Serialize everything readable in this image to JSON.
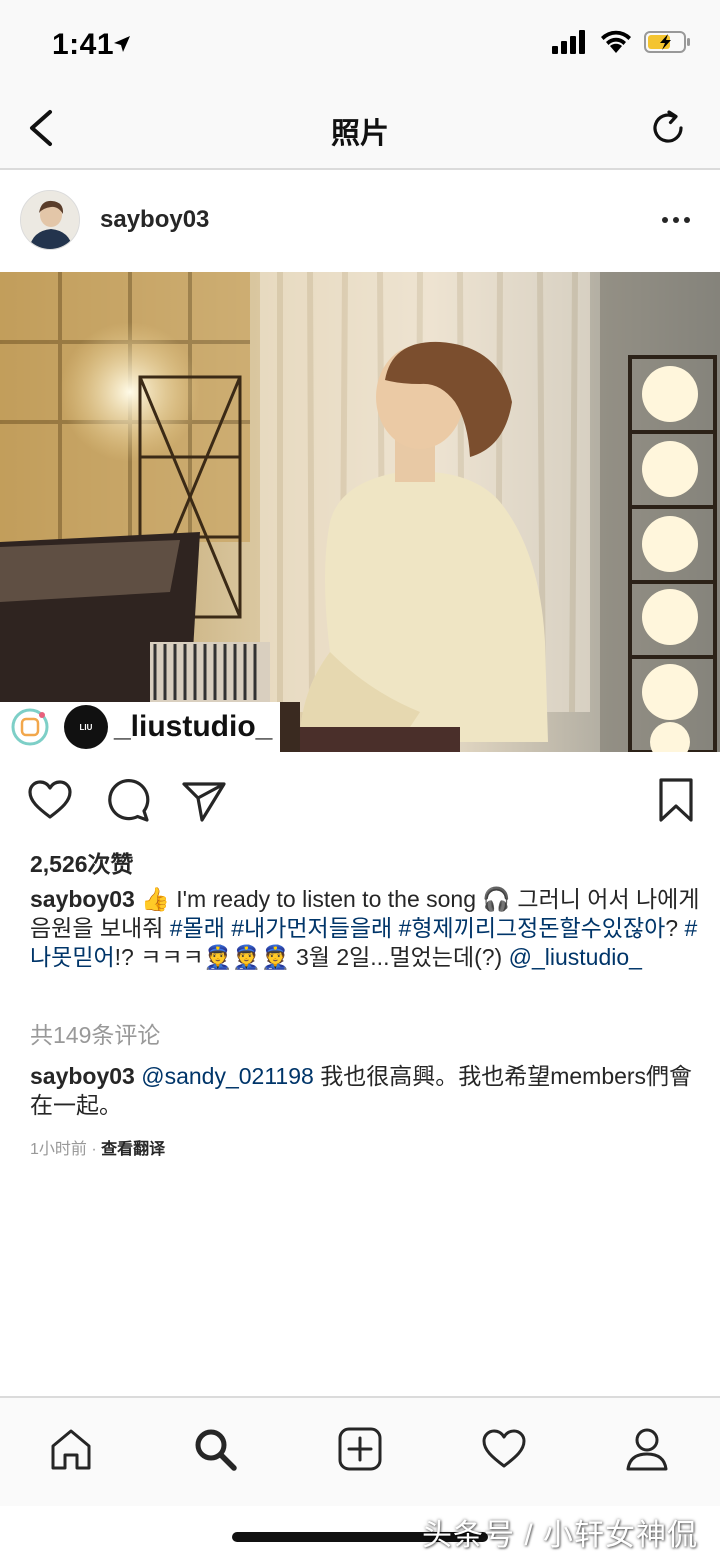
{
  "status_bar": {
    "time": "1:41"
  },
  "nav": {
    "title": "照片"
  },
  "post": {
    "username": "sayboy03",
    "photo_tag": "_liustudio_",
    "likes": "2,526次赞",
    "caption": {
      "username": "sayboy03",
      "text1": " 👍 I'm ready to listen to the song 🎧 그러니 어서 나에게 음원을 보내줘 ",
      "tag1": "#몰래",
      "tag2": "#내가먼저들을래",
      "tag3": "#형제끼리그정돈할수있잖아",
      "text2": "? ",
      "tag4": "#나못믿어",
      "text3": "!? ㅋㅋㅋ👮👮👮 3월 2일...멀었는데(?) ",
      "mention": "@_liustudio_"
    },
    "view_comments": "共149条评论",
    "comment": {
      "username": "sayboy03",
      "mention": "@sandy_021198",
      "text": " 我也很高興。我也希望members們會在一起。"
    },
    "comment_time": "1小时前 · ",
    "comment_translate": "查看翻译"
  },
  "watermark": "头条号 / 小轩女神侃",
  "icons": {
    "back": "chevron-left-icon",
    "refresh": "refresh-icon",
    "more": "more-icon",
    "like": "heart-icon",
    "comment": "comment-icon",
    "share": "send-icon",
    "save": "bookmark-icon",
    "home": "home-icon",
    "search": "search-icon",
    "add": "add-icon",
    "activity": "heart-icon",
    "profile": "profile-icon"
  }
}
